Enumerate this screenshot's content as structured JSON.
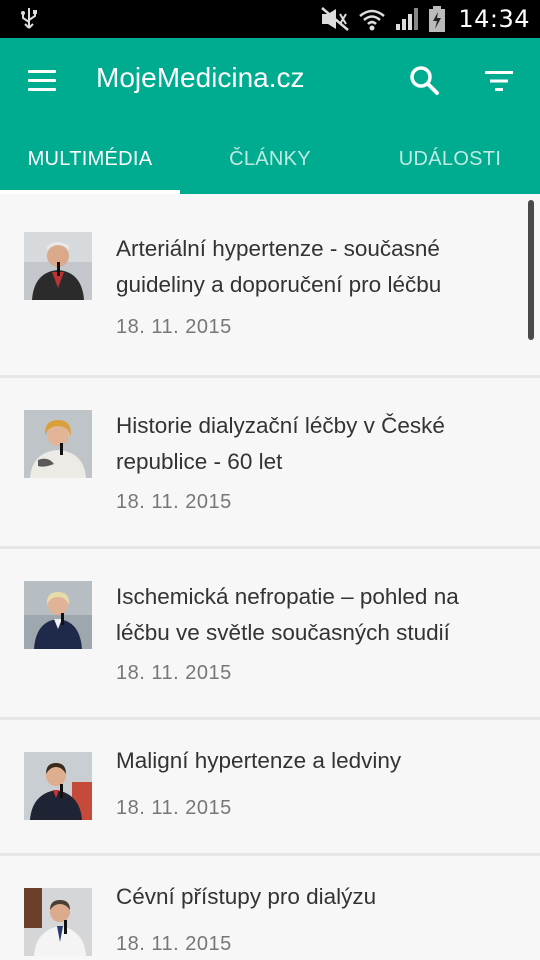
{
  "status_bar": {
    "time": "14:34",
    "icons": [
      "usb-icon",
      "mute-icon",
      "wifi-icon",
      "signal-icon",
      "battery-icon"
    ]
  },
  "app_bar": {
    "title": "MojeMedicina.cz",
    "menu_icon": "hamburger-menu-icon",
    "search_icon": "search-icon",
    "filter_icon": "filter-icon",
    "color": "#00ac8f"
  },
  "tabs": [
    {
      "label": "MULTIMÉDIA",
      "active": true
    },
    {
      "label": "ČLÁNKY",
      "active": false
    },
    {
      "label": "UDÁLOSTI",
      "active": false
    }
  ],
  "items": [
    {
      "title": "Arteriální hypertenze - současné guideliny a doporučení pro léčbu",
      "date": "18. 11. 2015",
      "thumb": "lecturer-photo"
    },
    {
      "title": "Historie dialyzační léčby v České republice - 60 let",
      "date": "18. 11. 2015",
      "thumb": "lecturer-photo"
    },
    {
      "title": "Ischemická nefropatie – pohled na léčbu ve světle současných studií",
      "date": "18. 11. 2015",
      "thumb": "lecturer-photo"
    },
    {
      "title": "Maligní hypertenze a ledviny",
      "date": "18. 11. 2015",
      "thumb": "lecturer-photo"
    },
    {
      "title": "Cévní přístupy pro dialýzu",
      "date": "18. 11. 2015",
      "thumb": "lecturer-photo"
    }
  ]
}
